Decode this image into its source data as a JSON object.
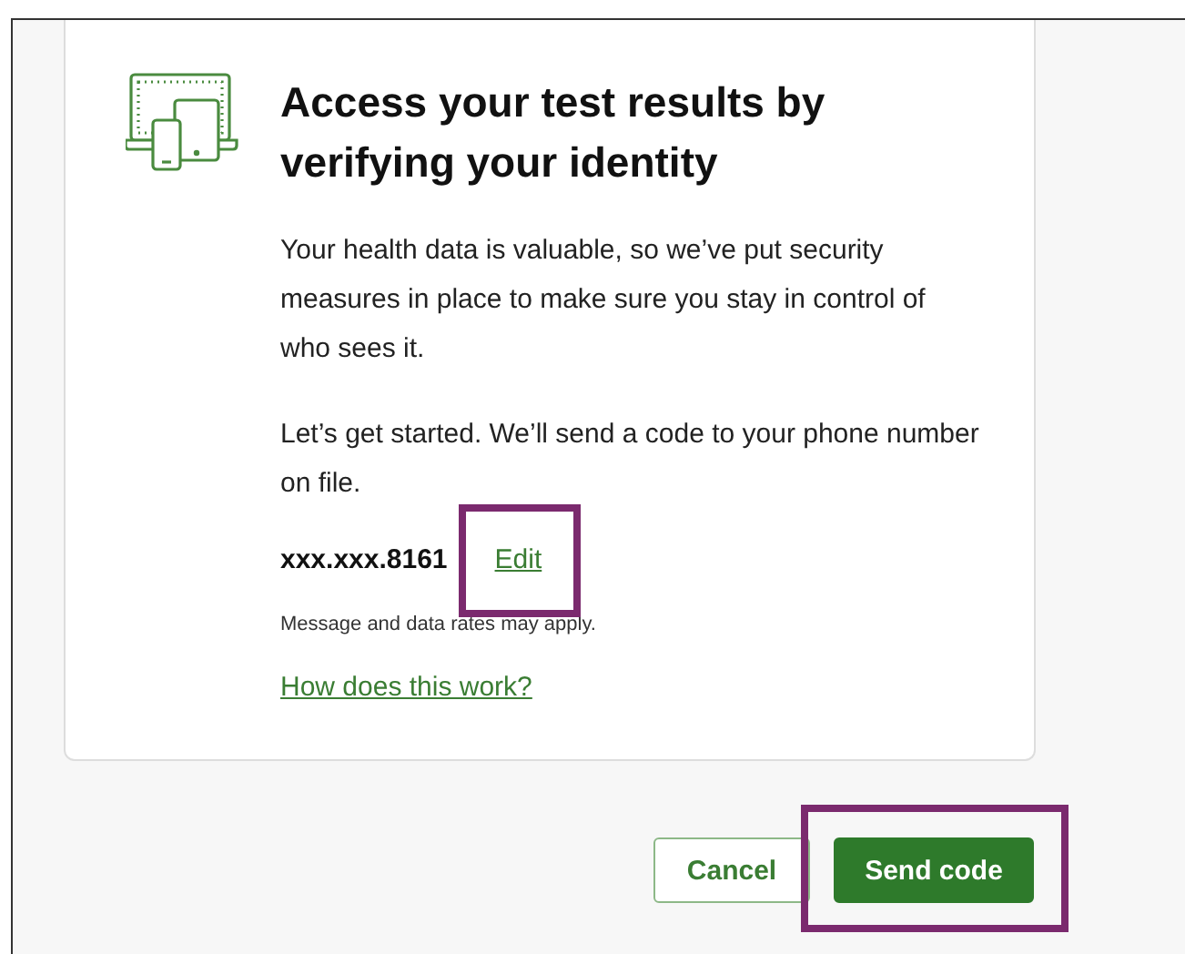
{
  "card": {
    "title": "Access your test results by verifying your identity",
    "paragraphs": [
      "Your health data is valuable, so we’ve put security measures in place to make sure you stay in control of who sees it.",
      "Let’s get started. We’ll send a code to your phone number on file."
    ],
    "phone": "xxx.xxx.8161",
    "edit_link": {
      "label": "Edit",
      "highlighted": true
    },
    "note": "Message and data rates may apply.",
    "help_link": {
      "label": "How does this work?",
      "highlighted": false
    }
  },
  "buttons": [
    {
      "label": "Cancel",
      "kind": "secondary",
      "highlighted": false
    },
    {
      "label": "Send code",
      "kind": "primary",
      "highlighted": true
    }
  ]
}
